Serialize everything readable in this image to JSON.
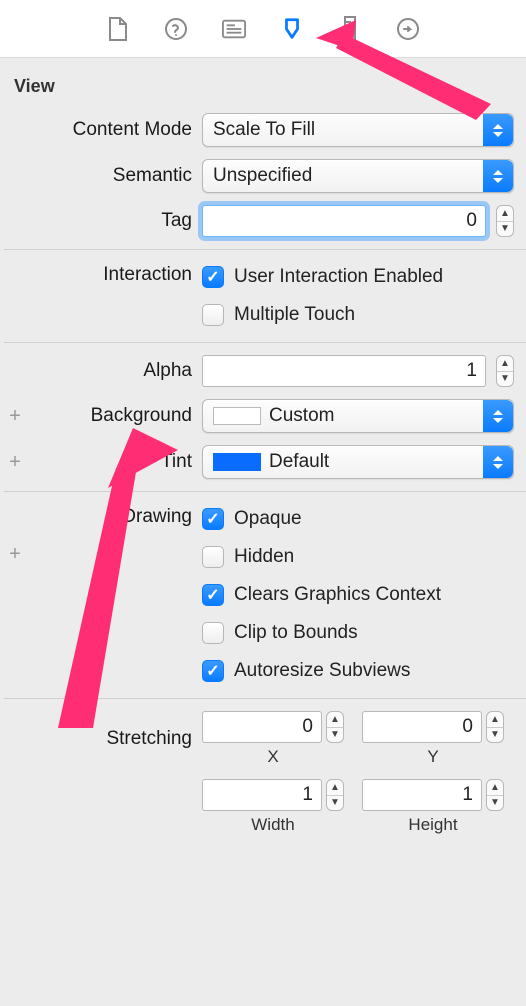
{
  "toolbar_icons": {
    "file": "file-icon",
    "help": "help-icon",
    "identity": "identity-icon",
    "attributes": "attributes-icon",
    "size": "size-icon",
    "connections": "connections-icon"
  },
  "section_title": "View",
  "labels": {
    "content_mode": "Content Mode",
    "semantic": "Semantic",
    "tag": "Tag",
    "interaction": "Interaction",
    "alpha": "Alpha",
    "background": "Background",
    "tint": "Tint",
    "drawing": "Drawing",
    "stretching": "Stretching",
    "x": "X",
    "y": "Y",
    "width": "Width",
    "height": "Height",
    "plus": "+"
  },
  "values": {
    "content_mode": "Scale To Fill",
    "semantic": "Unspecified",
    "tag": "0",
    "alpha": "1",
    "background": "Custom",
    "tint": "Default",
    "stretch_x": "0",
    "stretch_y": "0",
    "stretch_w": "1",
    "stretch_h": "1"
  },
  "interaction": {
    "user_interaction": {
      "label": "User Interaction Enabled",
      "checked": true
    },
    "multiple_touch": {
      "label": "Multiple Touch",
      "checked": false
    }
  },
  "drawing": {
    "opaque": {
      "label": "Opaque",
      "checked": true
    },
    "hidden": {
      "label": "Hidden",
      "checked": false
    },
    "clears": {
      "label": "Clears Graphics Context",
      "checked": true
    },
    "clip": {
      "label": "Clip to Bounds",
      "checked": false
    },
    "autoresize": {
      "label": "Autoresize Subviews",
      "checked": true
    }
  }
}
